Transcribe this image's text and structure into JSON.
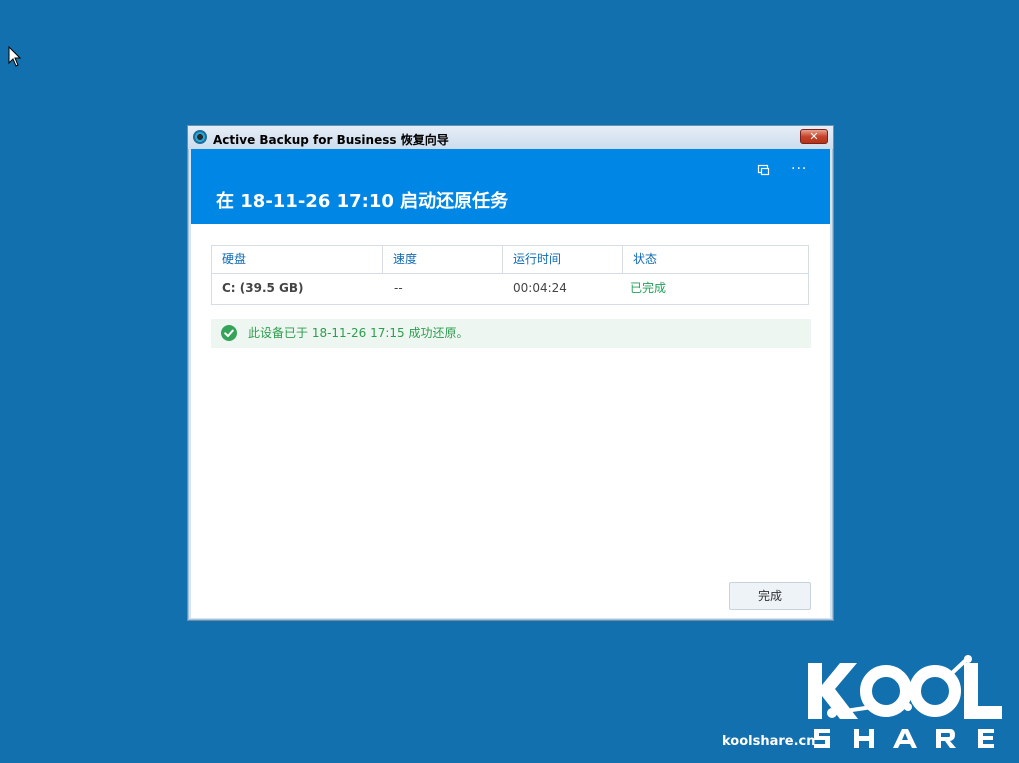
{
  "window": {
    "title": "Active Backup for Business 恢复向导",
    "close_glyph": "✕"
  },
  "header": {
    "title": "在 18-11-26 17:10 启动还原任务",
    "icons": [
      "restore-window-icon",
      "more-options-icon"
    ],
    "more_glyph": "···"
  },
  "table": {
    "columns": [
      "硬盘",
      "速度",
      "运行时间",
      "状态"
    ],
    "rows": [
      {
        "disk": "C: (39.5 GB)",
        "speed": "--",
        "runtime": "00:04:24",
        "status": "已完成"
      }
    ]
  },
  "message": {
    "text": "此设备已于 18-11-26 17:15 成功还原。"
  },
  "footer": {
    "finish_label": "完成"
  },
  "watermark": {
    "site": "koolshare.cn",
    "logo_text_top": "KOOL",
    "logo_text_bottom": "SHARE"
  },
  "colors": {
    "desktop": "#1170ad",
    "header_blue": "#0086e5",
    "success_green": "#2e9d4f"
  }
}
